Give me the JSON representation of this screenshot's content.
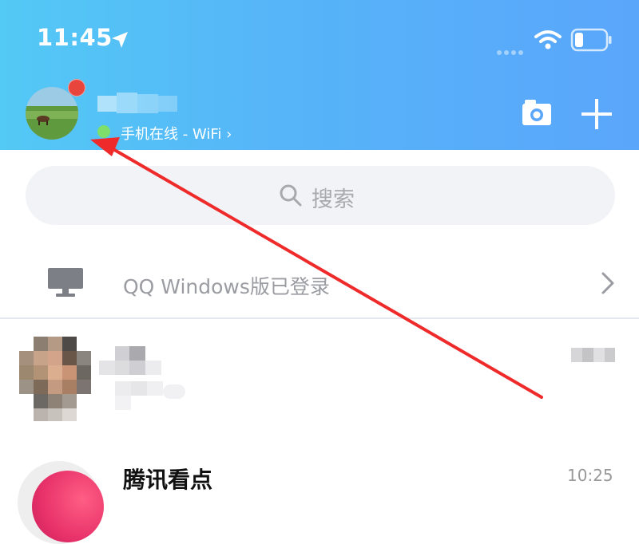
{
  "status_bar": {
    "time": "11:45",
    "icons": [
      "location-arrow-icon",
      "signal-dots-icon",
      "wifi-icon",
      "battery-icon"
    ]
  },
  "header": {
    "online_status": "手机在线 - WiFi",
    "chevron": "›",
    "actions": [
      "camera-icon",
      "plus-icon"
    ],
    "notification_color": "#e8453c",
    "online_color": "#7ee06a"
  },
  "search": {
    "placeholder": "搜索"
  },
  "device_row": {
    "label": "QQ Windows版已登录",
    "chevron": "›"
  },
  "chats": [
    {
      "name": "",
      "time": ""
    },
    {
      "name": "腾讯看点",
      "time": "10:25"
    }
  ],
  "colors": {
    "header_gradient": [
      "#53c9f5",
      "#5aa6fb"
    ],
    "annotation_arrow": "#ee2a2a",
    "search_bg": "#f2f3f6"
  }
}
